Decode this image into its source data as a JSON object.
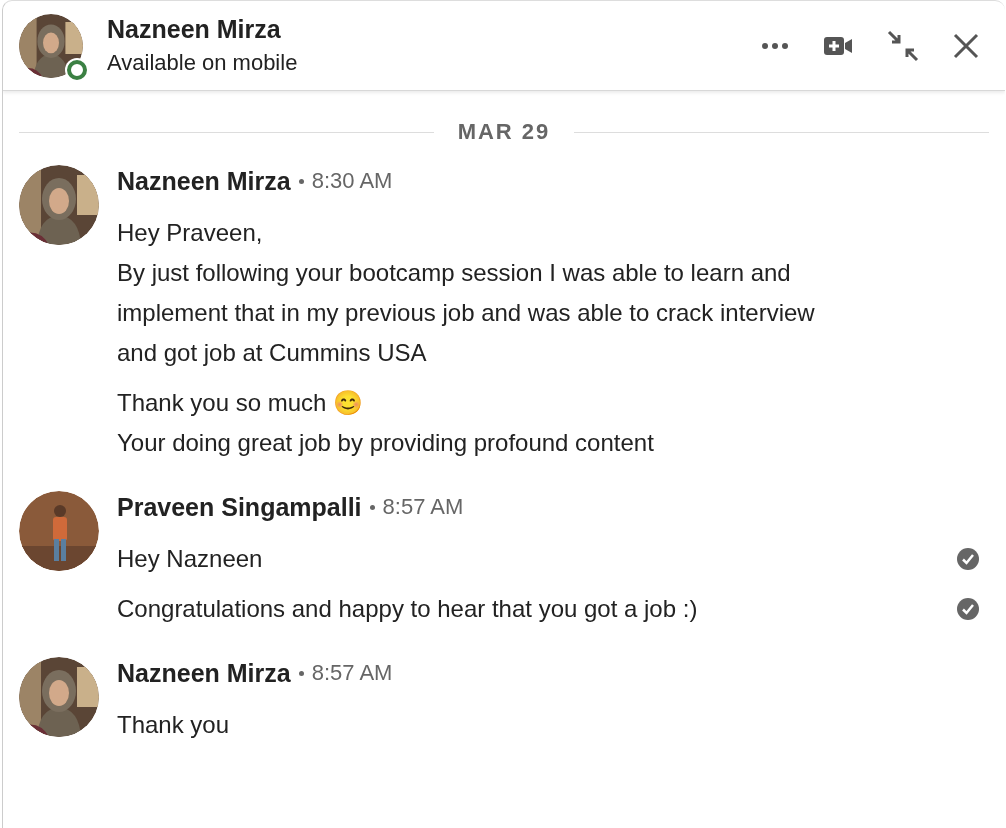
{
  "header": {
    "name": "Nazneen Mirza",
    "status": "Available on mobile",
    "online": true
  },
  "date_divider": "MAR 29",
  "messages": [
    {
      "sender": "Nazneen Mirza",
      "time": "8:30 AM",
      "kind": "woman",
      "paragraphs": [
        {
          "text": "Hey Praveen,\nBy just following your bootcamp session I was able to learn and implement that in my previous job and was able to crack interview and got job at Cummins USA",
          "read": false
        },
        {
          "text": "Thank you so much 😊\nYour doing great job by providing profound content",
          "read": false
        }
      ]
    },
    {
      "sender": "Praveen Singampalli",
      "time": "8:57 AM",
      "kind": "man",
      "paragraphs": [
        {
          "text": "Hey Nazneen",
          "read": true
        },
        {
          "text": "Congratulations and happy to hear that you got a job :)",
          "read": true
        }
      ]
    },
    {
      "sender": "Nazneen Mirza",
      "time": "8:57 AM",
      "kind": "woman",
      "paragraphs": [
        {
          "text": "Thank you",
          "read": false
        }
      ]
    }
  ]
}
